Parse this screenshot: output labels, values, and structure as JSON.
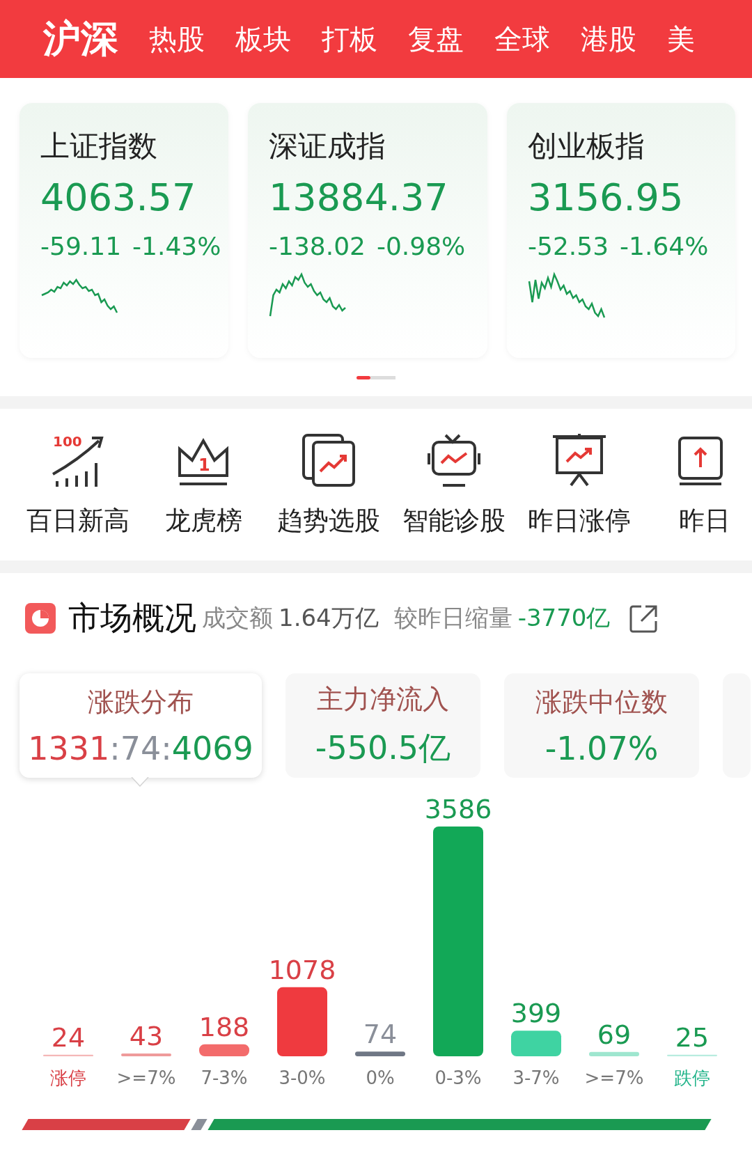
{
  "tabs": [
    {
      "label": "沪深",
      "selected": true
    },
    {
      "label": "热股",
      "selected": false
    },
    {
      "label": "板块",
      "selected": false
    },
    {
      "label": "打板",
      "selected": false
    },
    {
      "label": "复盘",
      "selected": false
    },
    {
      "label": "全球",
      "selected": false
    },
    {
      "label": "港股",
      "selected": false
    },
    {
      "label": "美",
      "selected": false
    }
  ],
  "indices": [
    {
      "name": "上证指数",
      "value": "4063.57",
      "change": "-59.11",
      "percent": "-1.43%"
    },
    {
      "name": "深证成指",
      "value": "13884.37",
      "change": "-138.02",
      "percent": "-0.98%"
    },
    {
      "name": "创业板指",
      "value": "3156.95",
      "change": "-52.53",
      "percent": "-1.64%"
    }
  ],
  "pager": [
    {
      "selected": true
    },
    {
      "selected": false
    }
  ],
  "shortcuts": [
    {
      "kind": "growth",
      "badge": "100",
      "label": "百日新高"
    },
    {
      "kind": "crown",
      "badge": "1",
      "label": "龙虎榜"
    },
    {
      "kind": "trend",
      "label": "趋势选股"
    },
    {
      "kind": "tv",
      "label": "智能诊股"
    },
    {
      "kind": "board",
      "label": "昨日涨停"
    },
    {
      "kind": "upload",
      "label": "昨日"
    }
  ],
  "market": {
    "title": "市场概况",
    "turnover_label": "成交额",
    "turnover": "1.64万亿",
    "compare_label": "较昨日缩量",
    "compare": "-3770亿",
    "stats": [
      {
        "title": "涨跌分布",
        "parts": [
          {
            "text": "1331",
            "color": "#d94046"
          },
          {
            "text": ":74:",
            "color": "#8a8f99"
          },
          {
            "text": "4069",
            "color": "#1a9a52"
          }
        ],
        "selected": true
      },
      {
        "title": "主力净流入",
        "value": "-550.5亿",
        "selected": false
      },
      {
        "title": "涨跌中位数",
        "value": "-1.07%",
        "selected": false
      }
    ],
    "distribution": {
      "chart_data": {
        "type": "bar",
        "categories": [
          "涨停",
          ">=7%",
          "7-3%",
          "3-0%",
          "0%",
          "0-3%",
          "3-7%",
          ">=7%",
          "跌停"
        ],
        "values": [
          24,
          43,
          188,
          1078,
          74,
          3586,
          399,
          69,
          25
        ],
        "data_labels": true
      },
      "bars": [
        {
          "color": "#f5b7b7"
        },
        {
          "color": "#ef9a9a"
        },
        {
          "color": "#f36b6b"
        },
        {
          "color": "#ef3a3f"
        },
        {
          "color": "#6f7785"
        },
        {
          "color": "#12a857"
        },
        {
          "color": "#3fd3a2"
        },
        {
          "color": "#9ee6cf"
        },
        {
          "color": "#b8ecdf"
        }
      ]
    }
  }
}
